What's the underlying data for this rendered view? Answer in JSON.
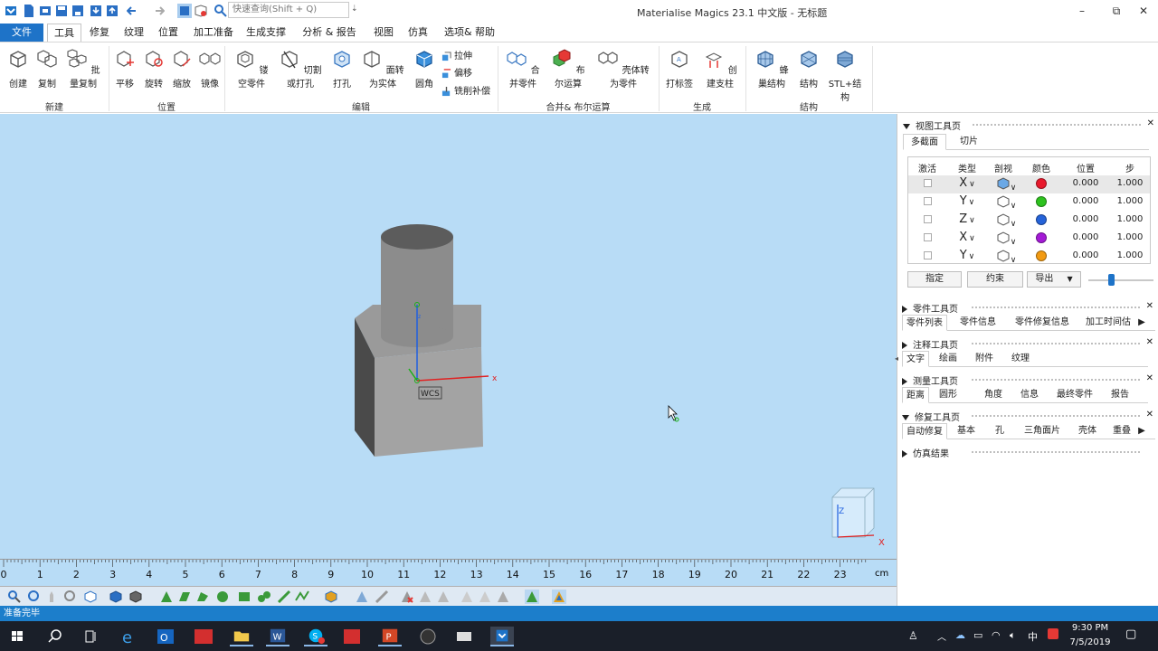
{
  "app": {
    "title": "Materialise Magics 23.1 中文版 - 无标题",
    "search_placeholder": "快速查询(Shift + Q)",
    "window_controls": {
      "minimize": "–",
      "restore": "⧉",
      "close": "✕"
    }
  },
  "menu": {
    "tabs": [
      "文件",
      "工具",
      "修复",
      "纹理",
      "位置",
      "加工准备",
      "生成支撑",
      "分析 & 报告",
      "视图",
      "仿真",
      "选项& 帮助"
    ]
  },
  "ribbon": {
    "groups": {
      "new": "新建",
      "position": "位置",
      "edit": "编辑",
      "merge": "合并& 布尔运算",
      "generate": "生成",
      "structure": "结构"
    },
    "buttons": {
      "create": "创建",
      "copy": "复制",
      "batch_copy": "批量复制",
      "translate": "平移",
      "rotate": "旋转",
      "scale": "缩放",
      "mirror": "镜像",
      "hollow": "镂空零件",
      "cut": "切割或打孔",
      "punch": "打孔",
      "surface_to_solid": "面转为实体",
      "fillet": "圆角",
      "extrude": "拉伸",
      "offset": "偏移",
      "milling": "铣削补偿",
      "merge_parts": "合并零件",
      "boolean": "布尔运算",
      "shell_to_part": "壳体转为零件",
      "label": "打标签",
      "create_support": "创建支柱",
      "honeycomb": "蜂巢结构",
      "structure": "结构",
      "stl_structure": "STL+结构"
    }
  },
  "viewport": {
    "wcs_label": "WCS",
    "axis_x": "x",
    "axis_z": "z",
    "nav_cube_z": "Z",
    "nav_cube_x": "X"
  },
  "ruler": {
    "ticks": [
      "0",
      "1",
      "2",
      "3",
      "4",
      "5",
      "6",
      "7",
      "8",
      "9",
      "10",
      "11",
      "12",
      "13",
      "14",
      "15",
      "16",
      "17",
      "18",
      "19",
      "20",
      "21",
      "22",
      "23"
    ],
    "unit": "cm"
  },
  "status": {
    "text": "准备完毕"
  },
  "view_page": {
    "title": "视图工具页",
    "tabs": [
      "多截面",
      "切片"
    ],
    "headers": [
      "激活",
      "类型",
      "剖视",
      "颜色",
      "位置",
      "步"
    ],
    "rows": [
      {
        "type": "X",
        "color": "#e8192c",
        "position": "0.000",
        "step": "1.000"
      },
      {
        "type": "Y",
        "color": "#2dc21e",
        "position": "0.000",
        "step": "1.000"
      },
      {
        "type": "Z",
        "color": "#2563d9",
        "position": "0.000",
        "step": "1.000"
      },
      {
        "type": "X",
        "color": "#a41ad6",
        "position": "0.000",
        "step": "1.000"
      },
      {
        "type": "Y",
        "color": "#f29a12",
        "position": "0.000",
        "step": "1.000"
      }
    ],
    "buttons": {
      "assign": "指定",
      "constrain": "约束",
      "export": "导出"
    },
    "slider_value": 0.35
  },
  "part_page": {
    "title": "零件工具页",
    "tabs": [
      "零件列表",
      "零件信息",
      "零件修复信息",
      "加工时间估"
    ]
  },
  "annotation_page": {
    "title": "注释工具页",
    "tabs": [
      "文字",
      "绘画",
      "附件",
      "纹理"
    ]
  },
  "measure_page": {
    "title": "测量工具页",
    "tabs": [
      "距离",
      "圆形",
      "角度",
      "信息",
      "最终零件",
      "报告"
    ]
  },
  "repair_page": {
    "title": "修复工具页",
    "tabs": [
      "自动修复",
      "基本",
      "孔",
      "三角面片",
      "壳体",
      "重叠"
    ]
  },
  "sim_page": {
    "title": "仿真结果"
  },
  "taskbar": {
    "time": "9:30 PM",
    "date": "7/5/2019",
    "ime": "中",
    "apps": [
      "start",
      "search",
      "taskview",
      "edge",
      "outlook",
      "youdao",
      "explorer",
      "word",
      "skype",
      "acrobat",
      "powerpoint",
      "app1",
      "app2",
      "magics"
    ]
  },
  "colors": {
    "accent": "#1e73c8",
    "viewport_bg": "#b8dcf6",
    "status_bar": "#1c7ecb"
  }
}
